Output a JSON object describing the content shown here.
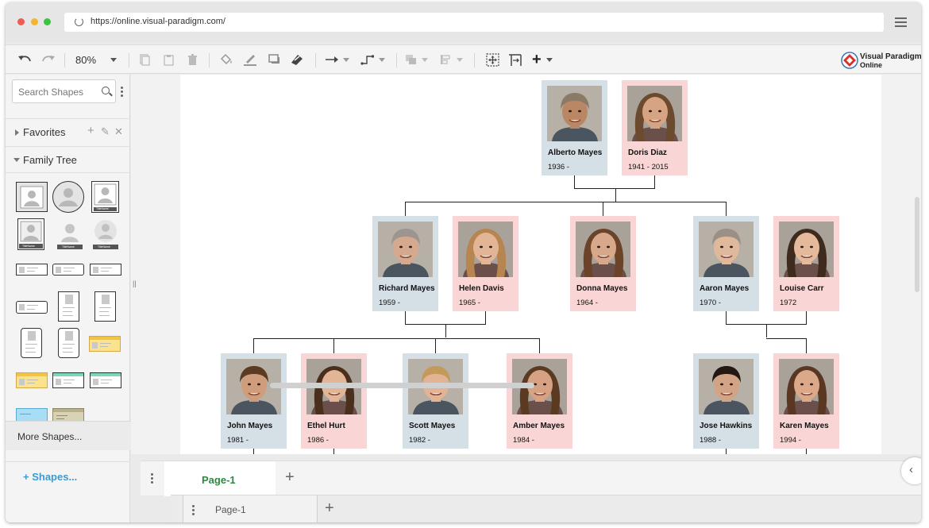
{
  "browser": {
    "url": "https://online.visual-paradigm.com/",
    "traffic_lights": [
      "#ee5d55",
      "#f5b52f",
      "#3dc33f"
    ]
  },
  "toolbar": {
    "zoom": "80%",
    "brand_line1": "Visual Paradigm",
    "brand_line2": "Online"
  },
  "sidebar": {
    "search_placeholder": "Search Shapes",
    "favorites": "Favorites",
    "family_tree": "Family Tree",
    "shape_caption": "TitleName",
    "shapes_link": "+ Shapes...",
    "more_shapes": "More Shapes..."
  },
  "family": [
    {
      "name": "Alberto Mayes",
      "years": "1936 -",
      "gender": "m",
      "skin": "#b98764",
      "hair": "#8a7a66"
    },
    {
      "name": "Doris Diaz",
      "years": "1941 - 2015",
      "gender": "f",
      "skin": "#d7a483",
      "hair": "#6b4a2e"
    },
    {
      "name": "Richard Mayes",
      "years": "1959 -",
      "gender": "m",
      "skin": "#d4a98e",
      "hair": "#9c9590"
    },
    {
      "name": "Helen Davis",
      "years": "1965 -",
      "gender": "f",
      "skin": "#e1b596",
      "hair": "#b88450"
    },
    {
      "name": "Donna Mayes",
      "years": "1964 -",
      "gender": "f",
      "skin": "#d8a88a",
      "hair": "#6a4328"
    },
    {
      "name": "Aaron Mayes",
      "years": "1970 -",
      "gender": "m",
      "skin": "#e0b89c",
      "hair": "#9a9086"
    },
    {
      "name": "Louise Carr",
      "years": "1972",
      "gender": "f",
      "skin": "#e5b99c",
      "hair": "#3f2a1e"
    },
    {
      "name": "John Mayes",
      "years": "1981 -",
      "gender": "m",
      "skin": "#cf9d7b",
      "hair": "#5b3b22"
    },
    {
      "name": "Ethel Hurt",
      "years": "1986 -",
      "gender": "f",
      "skin": "#e3b597",
      "hair": "#4a2f1d"
    },
    {
      "name": "Scott Mayes",
      "years": "1982 -",
      "gender": "m",
      "skin": "#e2b394",
      "hair": "#c49a5a"
    },
    {
      "name": "Amber Mayes",
      "years": "1984 -",
      "gender": "f",
      "skin": "#d7a283",
      "hair": "#5b3a22"
    },
    {
      "name": "Jose Hawkins",
      "years": "1988 -",
      "gender": "m",
      "skin": "#d3a385",
      "hair": "#241812"
    },
    {
      "name": "Karen Mayes",
      "years": "1994 -",
      "gender": "f",
      "skin": "#dca88a",
      "hair": "#5a3722"
    }
  ],
  "pages": {
    "tab1": "Page-1",
    "tab2": "Page-1"
  }
}
